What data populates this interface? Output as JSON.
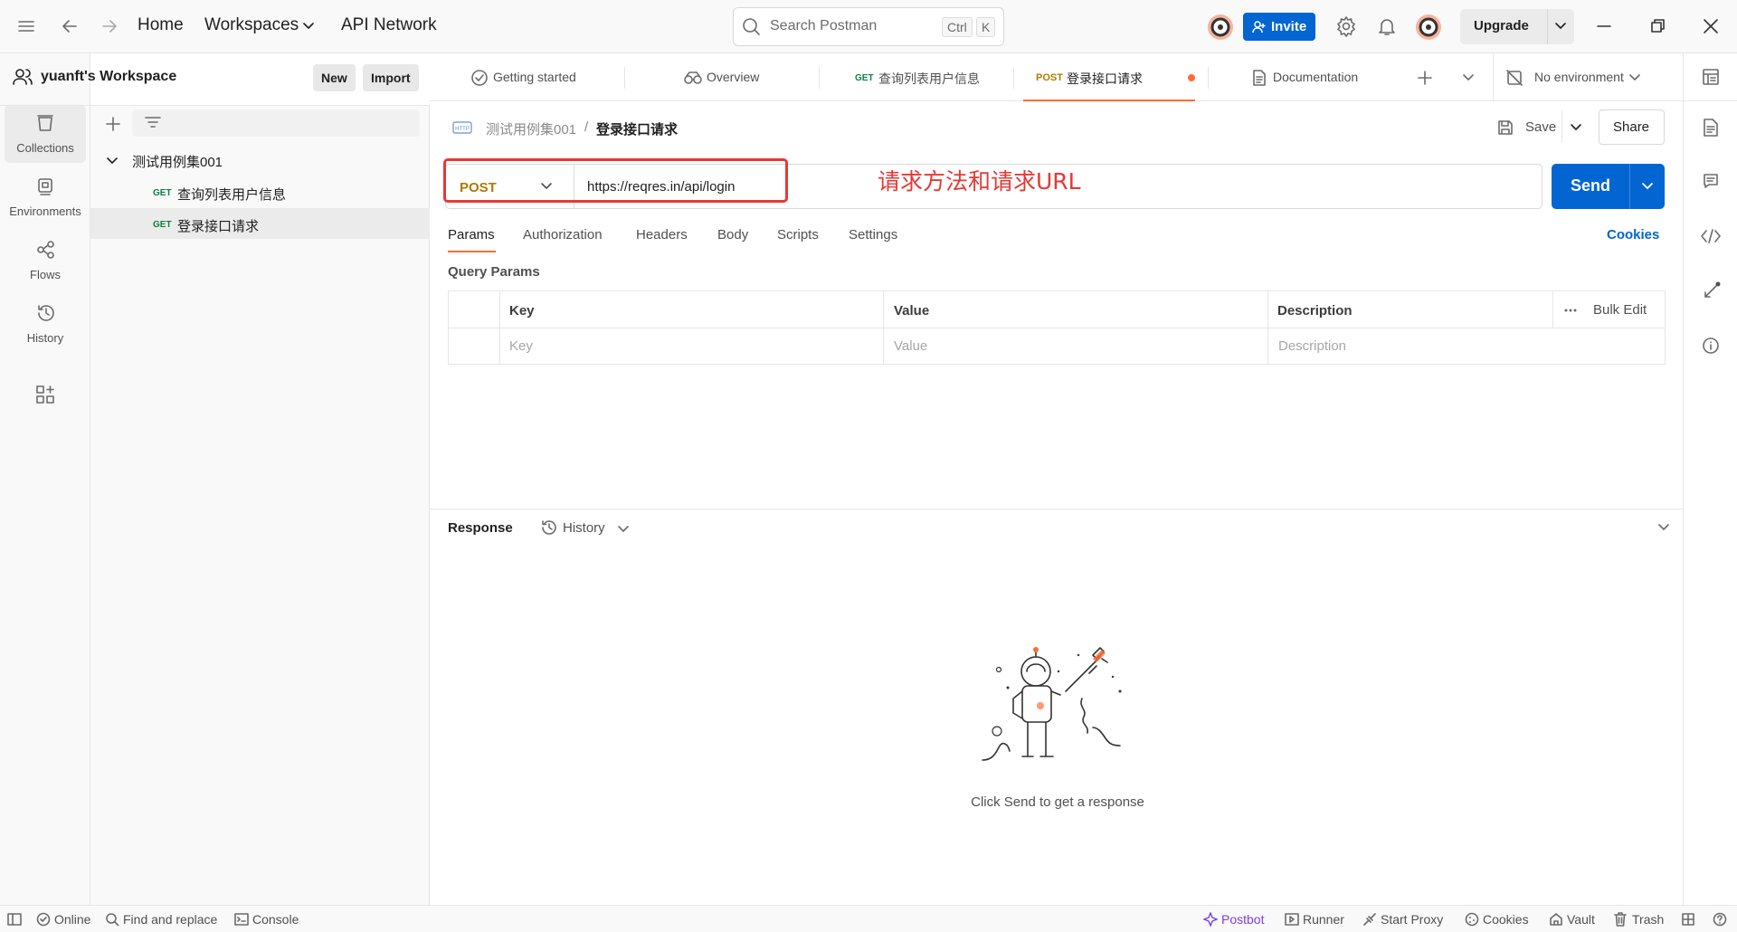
{
  "topbar": {
    "home": "Home",
    "workspaces": "Workspaces",
    "api_network": "API Network",
    "search_placeholder": "Search Postman",
    "shortcut_ctrl": "Ctrl",
    "shortcut_k": "K",
    "invite": "Invite",
    "upgrade": "Upgrade"
  },
  "rail": {
    "items": [
      {
        "label": "Collections"
      },
      {
        "label": "Environments"
      },
      {
        "label": "Flows"
      },
      {
        "label": "History"
      }
    ]
  },
  "sidebar": {
    "workspace_name": "yuanft's Workspace",
    "new_label": "New",
    "import_label": "Import",
    "collection": "测试用例集001",
    "requests": [
      {
        "method": "GET",
        "name": "查询列表用户信息"
      },
      {
        "method": "GET",
        "name": "登录接口请求"
      }
    ]
  },
  "tabs": {
    "items": [
      {
        "label": "Getting started"
      },
      {
        "label": "Overview"
      },
      {
        "method": "GET",
        "label": "查询列表用户信息"
      },
      {
        "method": "POST",
        "label": "登录接口请求"
      },
      {
        "label": "Documentation"
      }
    ],
    "environment": "No environment"
  },
  "request": {
    "breadcrumb_collection": "测试用例集001",
    "breadcrumb_sep": "/",
    "breadcrumb_request": "登录接口请求",
    "save": "Save",
    "share": "Share",
    "method": "POST",
    "url": "https://reqres.in/api/login",
    "send": "Send",
    "annotation": "请求方法和请求URL",
    "subtabs": [
      "Params",
      "Authorization",
      "Headers",
      "Body",
      "Scripts",
      "Settings"
    ],
    "cookies": "Cookies",
    "query_params_title": "Query Params",
    "table": {
      "headers": [
        "Key",
        "Value",
        "Description"
      ],
      "bulk_edit": "Bulk Edit",
      "placeholders": [
        "Key",
        "Value",
        "Description"
      ]
    }
  },
  "response": {
    "title": "Response",
    "history": "History",
    "empty_text": "Click Send to get a response"
  },
  "statusbar": {
    "online": "Online",
    "find_replace": "Find and replace",
    "console": "Console",
    "postbot": "Postbot",
    "runner": "Runner",
    "start_proxy": "Start Proxy",
    "cookies": "Cookies",
    "vault": "Vault",
    "trash": "Trash"
  },
  "colors": {
    "brand_blue": "#0265d2",
    "post_method": "#ad7a03",
    "get_method": "#0a7f47",
    "annotation_red": "#e53935",
    "tab_active_underline": "#ff6c37"
  }
}
